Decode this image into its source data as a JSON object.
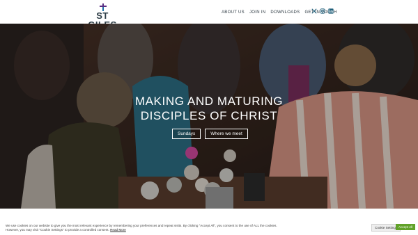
{
  "brand": {
    "name": "ST GILES",
    "logo_colors": [
      "#1a6fa6",
      "#5a2d82"
    ]
  },
  "nav": {
    "items": [
      {
        "label": "ABOUT US"
      },
      {
        "label": "JOIN IN"
      },
      {
        "label": "DOWNLOADS"
      },
      {
        "label": "GET IN TOUCH"
      }
    ]
  },
  "social": {
    "icons": [
      "x-twitter-icon",
      "instagram-icon",
      "linkedin-icon"
    ]
  },
  "hero": {
    "title_line1": "MAKING AND MATURING",
    "title_line2": "DISCIPLES OF CHRIST",
    "buttons": [
      {
        "label": "Sundays"
      },
      {
        "label": "Where we meet"
      }
    ]
  },
  "cookie": {
    "text": "We use cookies on our website to give you the most relevant experience by remembering your preferences and repeat visits. By clicking “Accept All”, you consent to the use of ALL the cookies. However, you may visit \"Cookie Settings\" to provide a controlled consent.",
    "read_more": "Read More",
    "settings_label": "Cookie Settings",
    "accept_label": "Accept All",
    "accept_color": "#61a229"
  }
}
